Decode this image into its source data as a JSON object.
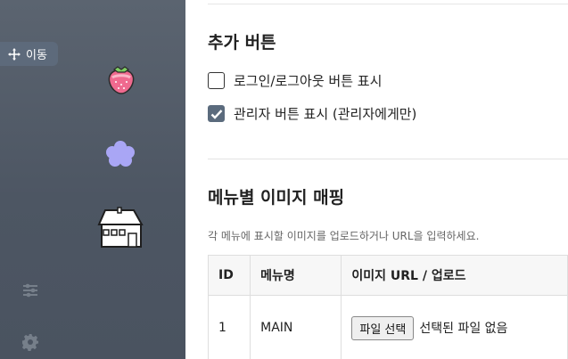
{
  "sidebar": {
    "move_label": "이동"
  },
  "panel": {
    "extra_buttons_title": "추가 버튼",
    "checkboxes": [
      {
        "label": "로그인/로그아웃 버튼 표시",
        "checked": false
      },
      {
        "label": "관리자 버튼 표시 (관리자에게만)",
        "checked": true
      }
    ],
    "menu_images_title": "메뉴별 이미지 매핑",
    "menu_images_hint": "각 메뉴에 표시할 이미지를 업로드하거나 URL을 입력하세요.",
    "table": {
      "headers": [
        "ID",
        "메뉴명",
        "이미지 URL / 업로드"
      ],
      "rows": [
        {
          "id": "1",
          "name": "MAIN",
          "file_button": "파일 선택",
          "file_status": "선택된 파일 없음"
        }
      ]
    }
  }
}
